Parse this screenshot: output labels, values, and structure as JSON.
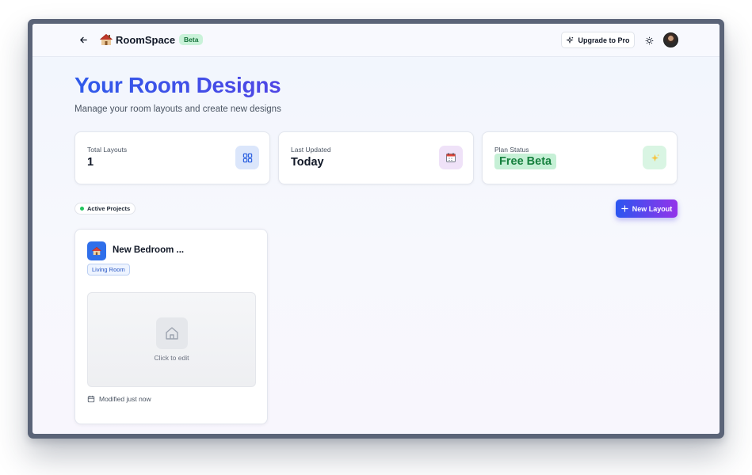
{
  "header": {
    "brand": "RoomSpace",
    "brand_emoji": "🏠",
    "beta_label": "Beta",
    "upgrade_label": "Upgrade to Pro"
  },
  "page": {
    "title": "Your Room Designs",
    "subtitle": "Manage your room layouts and create new designs"
  },
  "stats": [
    {
      "label": "Total Layouts",
      "value": "1",
      "icon": "grid-icon",
      "icon_bg": "#dbe6fb",
      "icon_color": "#2f63e0"
    },
    {
      "label": "Last Updated",
      "value": "Today",
      "icon": "calendar-icon",
      "icon_bg": "#efe2f8",
      "icon_color": "#a855f7"
    },
    {
      "label": "Plan Status",
      "value": "Free Beta",
      "icon": "sparkles-icon",
      "icon_bg": "#d9f5e3",
      "icon_color": "#22c55e"
    }
  ],
  "section": {
    "badge": "Active Projects",
    "new_layout_label": "New Layout"
  },
  "layouts": [
    {
      "title": "New Bedroom ...",
      "room_type": "Living Room",
      "preview_hint": "Click to edit",
      "modified": "Modified just now"
    }
  ],
  "colors": {
    "accent": "#2f5bea",
    "accent_gradient_end": "#9333ea",
    "success": "#22c55e"
  }
}
